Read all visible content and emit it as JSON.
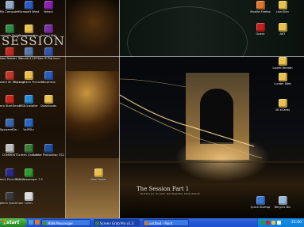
{
  "wallpaper": {
    "logo_text": "SESSION",
    "title": "The Session Part 1",
    "subtitle": "TROPICAL PLANT EXTENDED SEQUENCE"
  },
  "desktop_icons": [
    {
      "label": "My Computer",
      "icon": "computer-icon",
      "color": "#8fa9c9"
    },
    {
      "label": "Microsoft Word",
      "icon": "word-icon",
      "color": "#2b5cc4"
    },
    {
      "label": "Yahoo!",
      "icon": "yahoo-icon",
      "color": "#8b1fb4"
    },
    {
      "label": "Macromedia Dreamweaver 8",
      "icon": "dreamweaver-icon",
      "color": "#2f8a45"
    },
    {
      "label": "Dreamweaver",
      "icon": "folder-icon",
      "color": "#e8c24c"
    },
    {
      "label": "Yahoo! Mail",
      "icon": "mail-icon",
      "color": "#7a2fa8"
    },
    {
      "label": "Adobe Reader 7.0",
      "icon": "adobe-reader-icon",
      "color": "#c0281e"
    },
    {
      "label": "Bandit1112FP",
      "icon": "app-icon",
      "color": "#5577aa"
    },
    {
      "label": "Hide IP Platinum",
      "icon": "hide-ip-icon",
      "color": "#3355aa"
    },
    {
      "label": "AdAware SE Personal",
      "icon": "adaware-icon",
      "color": "#c03a2a"
    },
    {
      "label": "My Logitech Pictures",
      "icon": "folder-icon",
      "color": "#e8c24c"
    },
    {
      "label": "Morpheus",
      "icon": "morpheus-icon",
      "color": "#2a5dbf"
    },
    {
      "label": "Nero StartSmart",
      "icon": "nero-icon",
      "color": "#c8281e"
    },
    {
      "label": "MSN Installer",
      "icon": "msn-icon",
      "color": "#2a8ad6"
    },
    {
      "label": "Downloads",
      "icon": "folder-icon",
      "color": "#e8c24c"
    },
    {
      "label": "SpywareBla...",
      "icon": "spyware-icon",
      "color": "#3a66b0"
    },
    {
      "label": "VoIPStu",
      "icon": "voip-icon",
      "color": "#2a66c4"
    },
    {
      "label": "COMMENT",
      "icon": "comment-icon",
      "color": "#bcbcbc"
    },
    {
      "label": "Screen Grab Pro",
      "icon": "screen-grab-icon",
      "color": "#3a7a3a"
    },
    {
      "label": "Adobe Photoshop CS2",
      "icon": "photoshop-icon",
      "color": "#1e4fa3"
    },
    {
      "label": "Logitech Print Service",
      "icon": "logitech-print-icon",
      "color": "#2a2a8a"
    },
    {
      "label": "MSN Messenger 7.5",
      "icon": "msn-messenger-icon",
      "color": "#2e9a2e"
    },
    {
      "label": "Logitech QuickCam",
      "icon": "quickcam-icon",
      "color": "#3a3a3a"
    },
    {
      "label": "hmm",
      "icon": "text-file-icon",
      "color": "#dddddd"
    },
    {
      "label": "New Folder",
      "icon": "folder-icon",
      "color": "#e8c24c"
    },
    {
      "label": "Mozilla Firefox",
      "icon": "firefox-icon",
      "color": "#e0762a"
    },
    {
      "label": "Lisa Kilkc",
      "icon": "folder-icon",
      "color": "#e8c24c"
    },
    {
      "label": "Opera",
      "icon": "opera-icon",
      "color": "#c81e1e"
    },
    {
      "label": "ART",
      "icon": "folder-icon",
      "color": "#e8c24c"
    },
    {
      "label": "Laurel Wreath",
      "icon": "folder-icon",
      "color": "#e8c24c"
    },
    {
      "label": "Lunder Web",
      "icon": "folder-icon",
      "color": "#e8c24c"
    },
    {
      "label": "28 eCards",
      "icon": "folder-icon",
      "color": "#e8c24c"
    },
    {
      "label": "Quick Startup",
      "icon": "quick-startup-icon",
      "color": "#3a7ad6"
    },
    {
      "label": "Recycle Bin",
      "icon": "recycle-bin-icon",
      "color": "#9bb8d8"
    }
  ],
  "taskbar": {
    "start_label": "start",
    "tasks": [
      {
        "label": "MSN Messenger",
        "icon": "msn-messenger-icon",
        "color": "#2e9a2e"
      },
      {
        "label": "Screen Grab Pro v1.3",
        "icon": "screen-grab-icon",
        "color": "#3a7a3a"
      },
      {
        "label": "untitled - Paint",
        "icon": "paint-icon",
        "color": "#c87a2a"
      }
    ],
    "clock": "22:00"
  }
}
